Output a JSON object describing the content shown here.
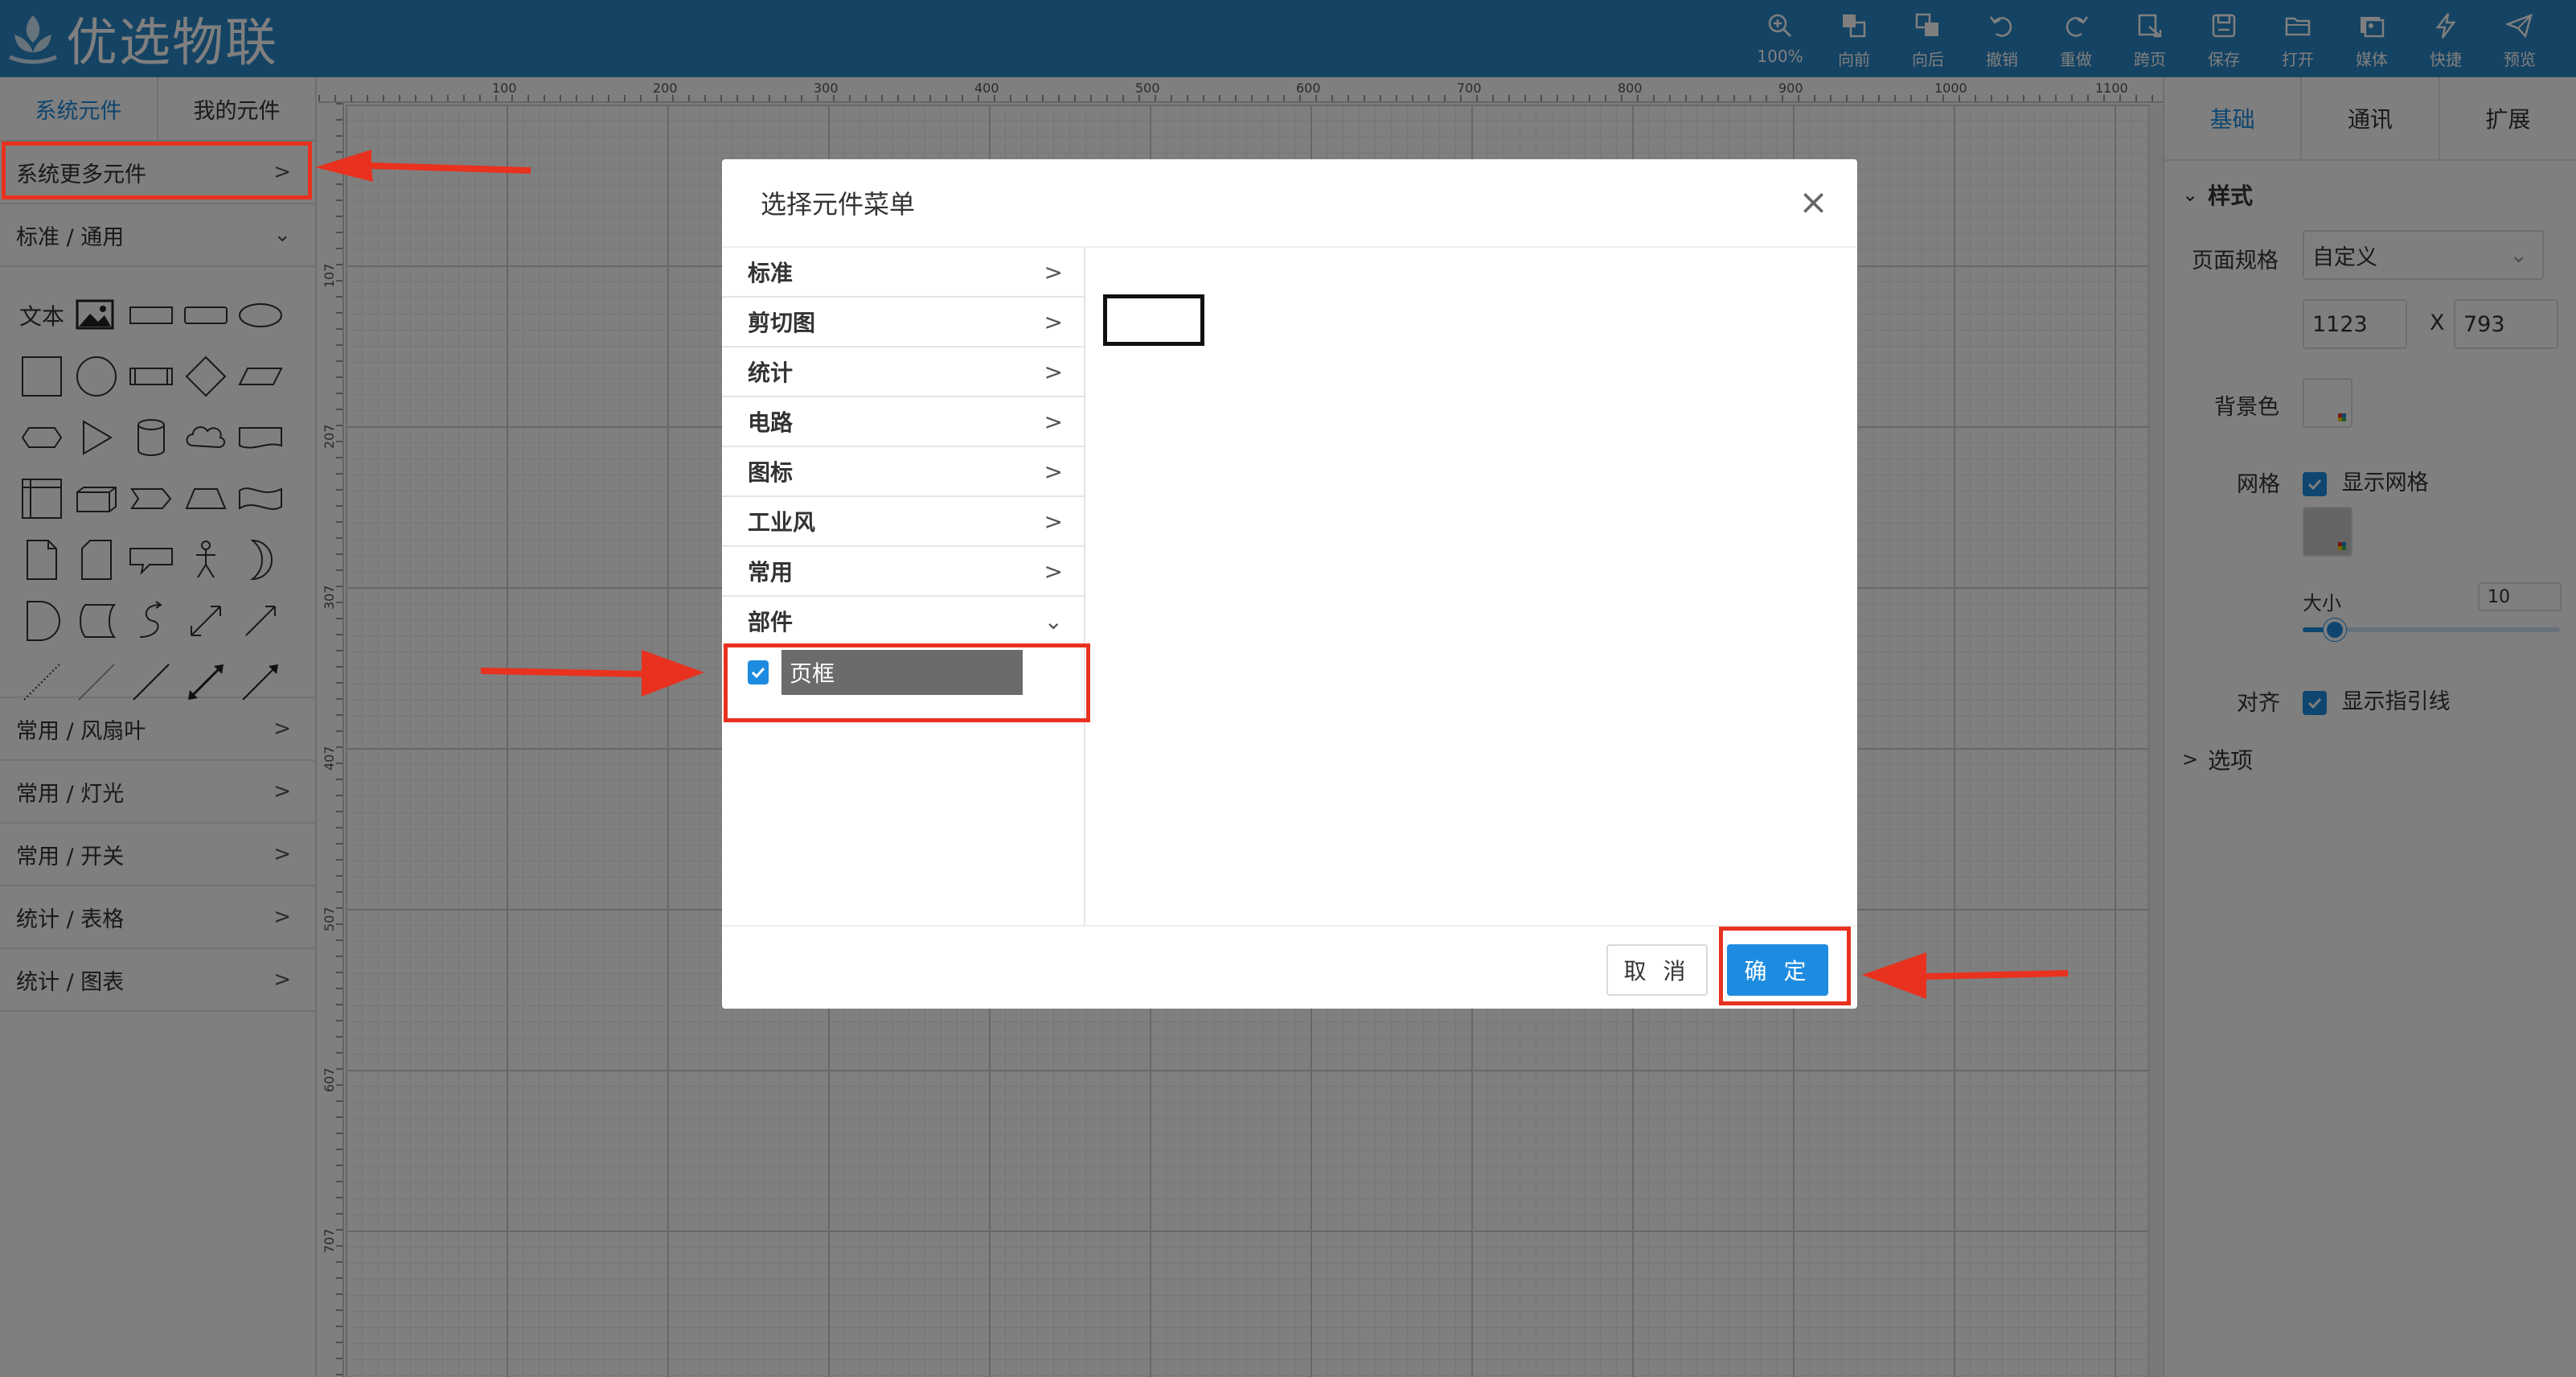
{
  "header": {
    "app_title": "优选物联",
    "toolbar": [
      {
        "label": "100%",
        "icon": "zoom-icon"
      },
      {
        "label": "向前",
        "icon": "bring-forward-icon"
      },
      {
        "label": "向后",
        "icon": "send-backward-icon"
      },
      {
        "label": "撤销",
        "icon": "undo-icon"
      },
      {
        "label": "重做",
        "icon": "redo-icon"
      },
      {
        "label": "跨页",
        "icon": "cross-page-icon"
      },
      {
        "label": "保存",
        "icon": "save-icon"
      },
      {
        "label": "打开",
        "icon": "open-folder-icon"
      },
      {
        "label": "媒体",
        "icon": "media-icon"
      },
      {
        "label": "快捷",
        "icon": "lightning-icon"
      },
      {
        "label": "预览",
        "icon": "send-icon"
      }
    ]
  },
  "left_panel": {
    "tabs": [
      "系统元件",
      "我的元件"
    ],
    "more_row": "系统更多元件",
    "standard_row": "标准 / 通用",
    "shape_text": "文本",
    "categories": [
      "常用 / 风扇叶",
      "常用 / 灯光",
      "常用 / 开关",
      "统计 / 表格",
      "统计 / 图表"
    ]
  },
  "ruler": {
    "top": [
      "100",
      "200",
      "300",
      "400",
      "500",
      "600",
      "700",
      "800",
      "900",
      "1000",
      "1100"
    ],
    "left": [
      "107",
      "207",
      "307",
      "407",
      "507",
      "607",
      "707"
    ]
  },
  "right_panel": {
    "tabs": [
      "基础",
      "通讯",
      "扩展"
    ],
    "style_section": "样式",
    "page_size_label": "页面规格",
    "page_size_value": "自定义",
    "width": "1123",
    "x_sep": "X",
    "height": "793",
    "bg_label": "背景色",
    "grid_label": "网格",
    "show_grid": "显示网格",
    "size_label": "大小",
    "size_value": "10",
    "align_label": "对齐",
    "show_guides": "显示指引线",
    "options_section": "选项"
  },
  "modal": {
    "title": "选择元件菜单",
    "menu": [
      "标准",
      "剪切图",
      "统计",
      "电路",
      "图标",
      "工业风",
      "常用",
      "部件"
    ],
    "expanded_item": "部件",
    "sub_item": "页框",
    "cancel": "取 消",
    "ok": "确 定"
  },
  "colors": {
    "header": "#2a86c7",
    "accent": "#1d8ce0",
    "annotation": "#e8321f"
  }
}
